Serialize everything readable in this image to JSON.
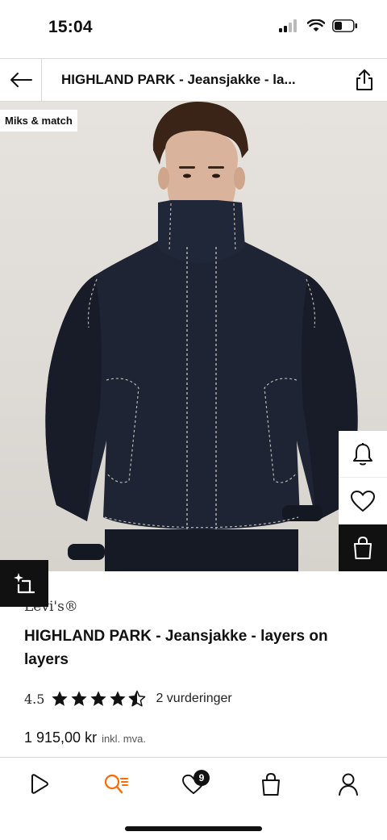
{
  "status_bar": {
    "time": "15:04"
  },
  "header": {
    "title": "HIGHLAND PARK - Jeansjakke - la..."
  },
  "hero": {
    "badge": "Miks & match"
  },
  "product": {
    "brand": "Levi's®",
    "name": "HIGHLAND PARK - Jeansjakke - layers on layers",
    "rating_value": "4.5",
    "rating_stars": 4.5,
    "rating_count": "2 vurderinger",
    "price": "1 915,00 kr",
    "price_note": "inkl. mva."
  },
  "nav": {
    "favorites_count": "9"
  },
  "colors": {
    "accent": "#ff6900",
    "dark": "#111111",
    "denim": "#1c2230"
  }
}
